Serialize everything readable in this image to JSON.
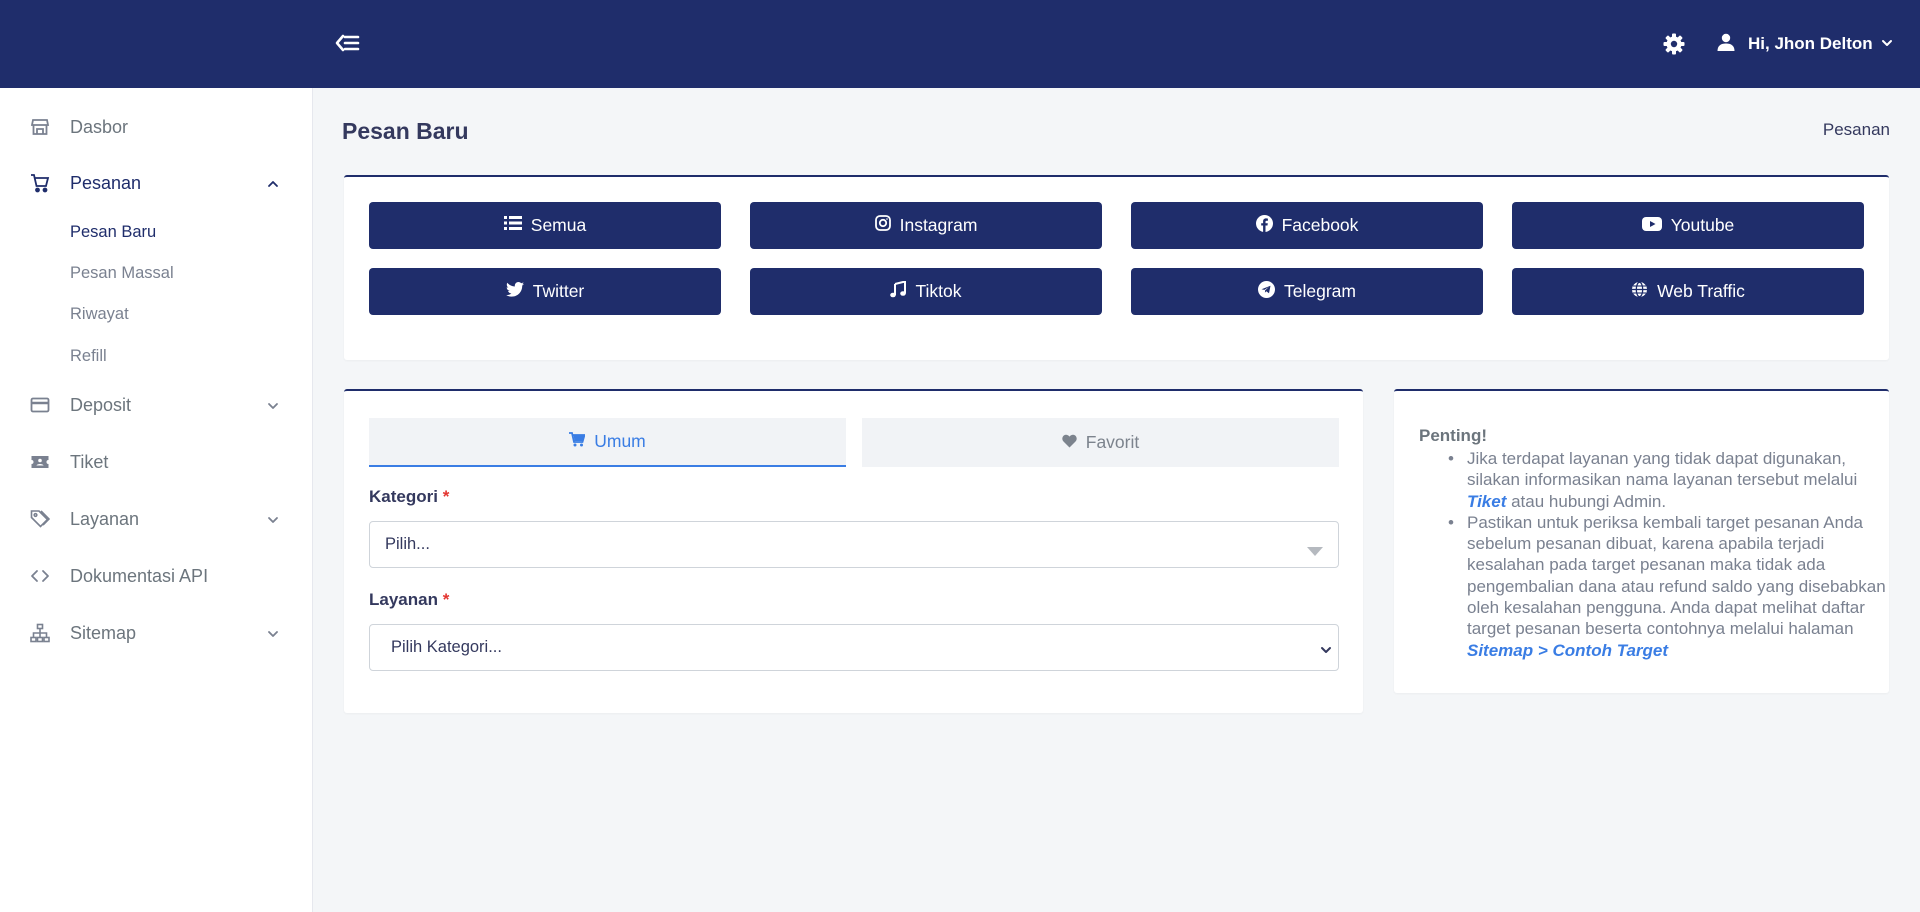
{
  "header": {
    "user_greeting": "Hi, Jhon Delton"
  },
  "sidebar": {
    "items": [
      {
        "label": "Dasbor",
        "icon": "store-icon"
      },
      {
        "label": "Pesanan",
        "icon": "cart-icon",
        "expanded": true
      },
      {
        "label": "Deposit",
        "icon": "credit-card-icon"
      },
      {
        "label": "Tiket",
        "icon": "ticket-icon"
      },
      {
        "label": "Layanan",
        "icon": "tags-icon"
      },
      {
        "label": "Dokumentasi API",
        "icon": "code-icon"
      },
      {
        "label": "Sitemap",
        "icon": "sitemap-icon"
      }
    ],
    "pesanan_sub": [
      "Pesan Baru",
      "Pesan Massal",
      "Riwayat",
      "Refill"
    ]
  },
  "page": {
    "title": "Pesan Baru",
    "breadcrumb": "Pesanan"
  },
  "platforms": [
    {
      "label": "Semua",
      "icon": "list-icon"
    },
    {
      "label": "Instagram",
      "icon": "instagram-icon"
    },
    {
      "label": "Facebook",
      "icon": "facebook-icon"
    },
    {
      "label": "Youtube",
      "icon": "youtube-icon"
    },
    {
      "label": "Twitter",
      "icon": "twitter-icon"
    },
    {
      "label": "Tiktok",
      "icon": "music-note-icon"
    },
    {
      "label": "Telegram",
      "icon": "telegram-icon"
    },
    {
      "label": "Web Traffic",
      "icon": "globe-icon"
    }
  ],
  "order_form": {
    "tabs": [
      {
        "label": "Umum",
        "icon": "cart-icon",
        "active": true
      },
      {
        "label": "Favorit",
        "icon": "heart-icon",
        "active": false
      }
    ],
    "kategori_label": "Kategori",
    "kategori_value": "Pilih...",
    "layanan_label": "Layanan",
    "layanan_value": "Pilih Kategori...",
    "required_mark": "*"
  },
  "info": {
    "title": "Penting!",
    "item1_text": "Jika terdapat layanan yang tidak dapat digunakan, silakan informasikan nama layanan tersebut melalui ",
    "item1_link": "Tiket",
    "item1_tail": " atau hubungi Admin.",
    "item2_text": "Pastikan untuk periksa kembali target pesanan Anda sebelum pesanan dibuat, karena apabila terjadi kesalahan pada target pesanan maka tidak ada pengembalian dana atau refund saldo yang disebabkan oleh kesalahan pengguna. Anda dapat melihat daftar target pesanan beserta contohnya melalui halaman ",
    "item2_link": "Sitemap > Contoh Target"
  },
  "colors": {
    "primary": "#1f2d6b",
    "accent": "#3a7de4",
    "required": "#e3342f",
    "background": "#f4f6f8"
  }
}
